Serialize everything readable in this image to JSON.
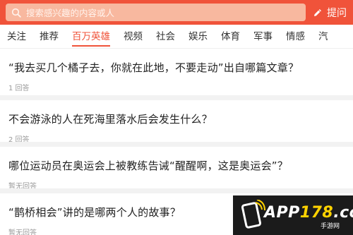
{
  "header": {
    "search_placeholder": "搜索感兴趣的内容或人",
    "ask_label": "提问",
    "search_icon": "search-icon",
    "pen_icon": "pen-icon",
    "accent_color": "#f0533a"
  },
  "tabs": [
    {
      "label": "关注"
    },
    {
      "label": "推荐"
    },
    {
      "label": "百万英雄",
      "active": true
    },
    {
      "label": "视频"
    },
    {
      "label": "社会"
    },
    {
      "label": "娱乐"
    },
    {
      "label": "体育"
    },
    {
      "label": "军事"
    },
    {
      "label": "情感"
    },
    {
      "label": "汽"
    }
  ],
  "questions": [
    {
      "title": "“我去买几个橘子去，你就在此地，不要走动”出自哪篇文章？",
      "meta": "1 回答"
    },
    {
      "title": "不会游泳的人在死海里落水后会发生什么？",
      "meta": "2 回答"
    },
    {
      "title": "哪位运动员在奥运会上被教练告诫“醒醒啊，这是奥运会”？",
      "meta": "暂无回答"
    },
    {
      "title": "“鹊桥相会”讲的是哪两个人的故事？",
      "meta": "暂无回答"
    }
  ],
  "watermark": {
    "prefix": "APP",
    "number": "178",
    "suffix": ".com",
    "sub": "手游网"
  }
}
